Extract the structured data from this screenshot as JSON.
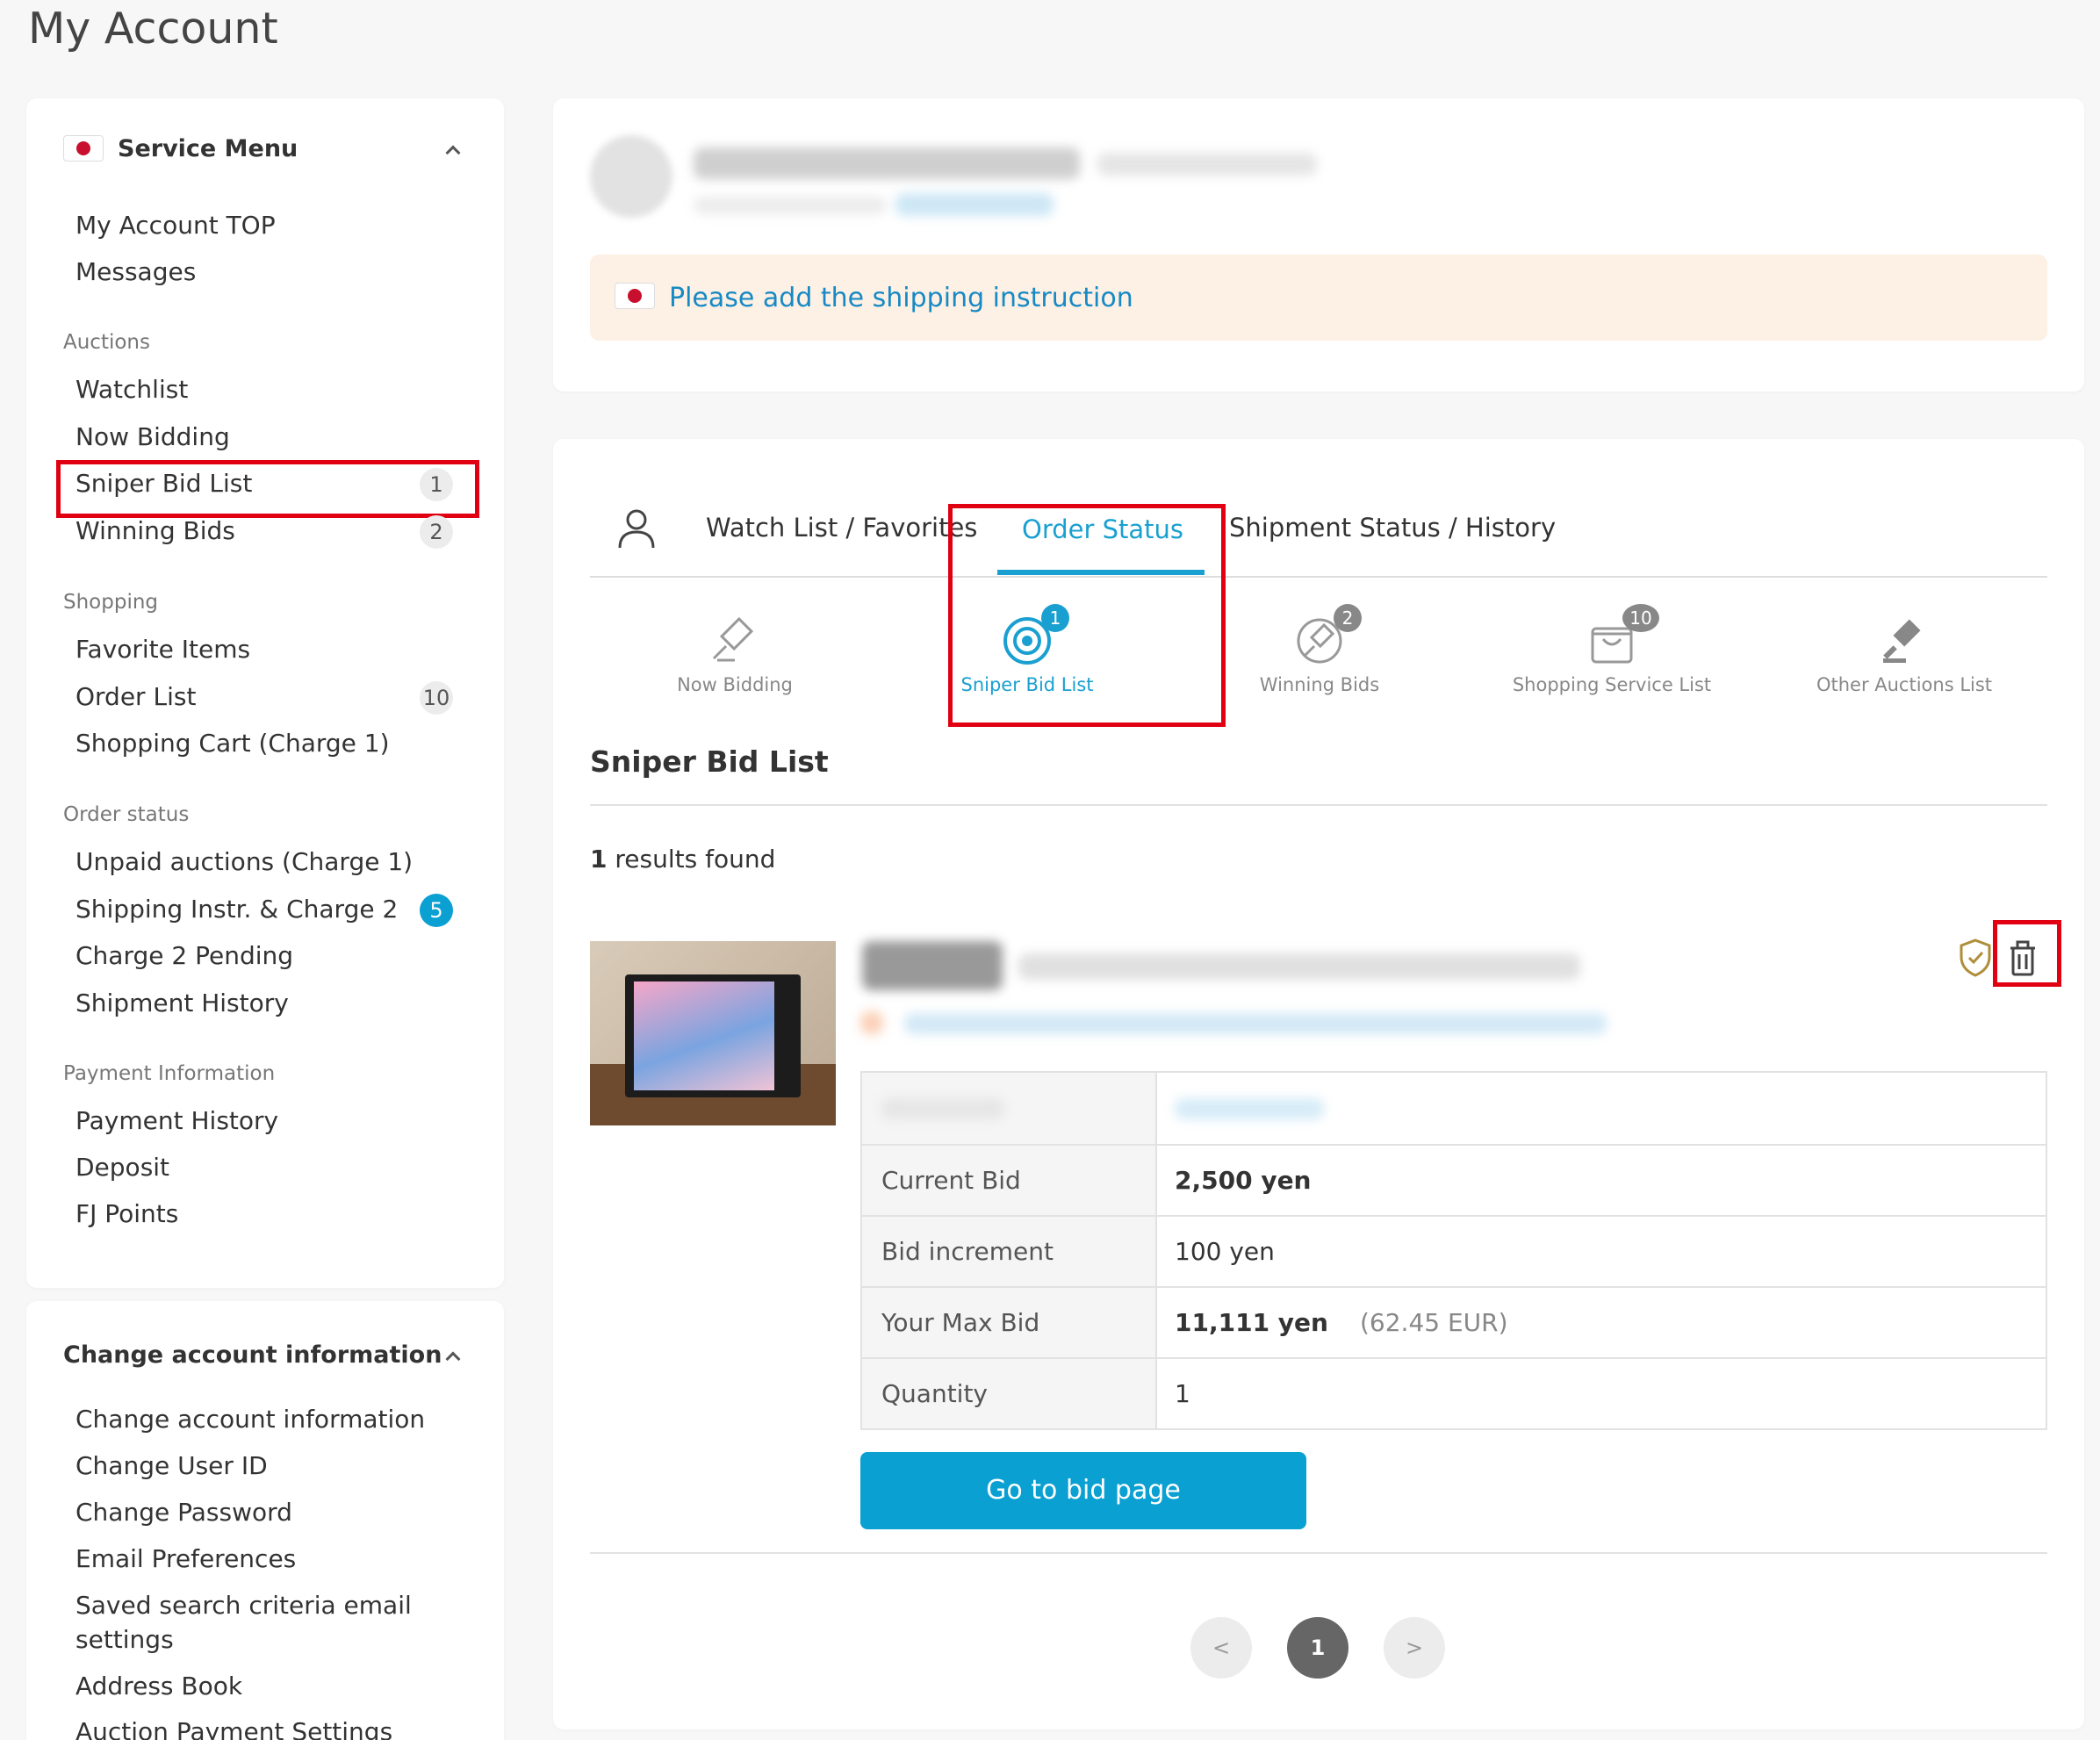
{
  "page": {
    "title": "My Account"
  },
  "sidebar": {
    "service_menu_title": "Service Menu",
    "items_top": [
      "My Account TOP",
      "Messages"
    ],
    "cat_auctions": "Auctions",
    "auctions": [
      {
        "label": "Watchlist",
        "badge": ""
      },
      {
        "label": "Now Bidding",
        "badge": ""
      },
      {
        "label": "Sniper Bid List",
        "badge": "1"
      },
      {
        "label": "Winning Bids",
        "badge": "2"
      }
    ],
    "cat_shopping": "Shopping",
    "shopping": [
      {
        "label": "Favorite Items",
        "badge": ""
      },
      {
        "label": "Order List",
        "badge": "10"
      },
      {
        "label": "Shopping Cart (Charge 1)",
        "badge": ""
      }
    ],
    "cat_order": "Order status",
    "order": [
      {
        "label": "Unpaid auctions (Charge 1)",
        "badge": ""
      },
      {
        "label": "Shipping Instr. & Charge 2",
        "badge": "5"
      },
      {
        "label": "Charge 2 Pending",
        "badge": ""
      },
      {
        "label": "Shipment History",
        "badge": ""
      }
    ],
    "cat_payment": "Payment Information",
    "payment": [
      "Payment History",
      "Deposit",
      "FJ Points"
    ],
    "change_title": "Change account information",
    "change": [
      "Change account information",
      "Change User ID",
      "Change Password",
      "Email Preferences",
      "Saved search criteria email",
      "settings",
      "Address Book",
      "Auction Payment Settings"
    ]
  },
  "notice": {
    "text": "Please add the shipping instruction"
  },
  "tabs": {
    "items": [
      "Watch List / Favorites",
      "Order Status",
      "Shipment Status / History"
    ],
    "active": "Order Status"
  },
  "sub_tabs": [
    {
      "label": "Now Bidding",
      "count": "",
      "icon": "gavel-icon"
    },
    {
      "label": "Sniper Bid List",
      "count": "1",
      "icon": "target-icon"
    },
    {
      "label": "Winning Bids",
      "count": "2",
      "icon": "winning-gavel-icon"
    },
    {
      "label": "Shopping Service List",
      "count": "10",
      "icon": "shopping-bag-icon"
    },
    {
      "label": "Other Auctions List",
      "count": "",
      "icon": "auction-hammer-icon"
    }
  ],
  "section": {
    "title": "Sniper Bid List",
    "results_count": "1",
    "results_suffix": " results found"
  },
  "item": {
    "current_bid_label": "Current Bid",
    "current_bid": "2,500 yen",
    "increment_label": "Bid increment",
    "increment": "100 yen",
    "max_bid_label": "Your Max Bid",
    "max_bid": "11,111 yen",
    "max_bid_eur": "(62.45 EUR)",
    "quantity_label": "Quantity",
    "quantity": "1",
    "button": "Go to bid page"
  },
  "pagination": {
    "prev": "<",
    "current": "1",
    "next": ">"
  },
  "colors": {
    "accent": "#0aa0d2",
    "highlight": "#e00012",
    "notice_bg": "#fdf0e5"
  }
}
